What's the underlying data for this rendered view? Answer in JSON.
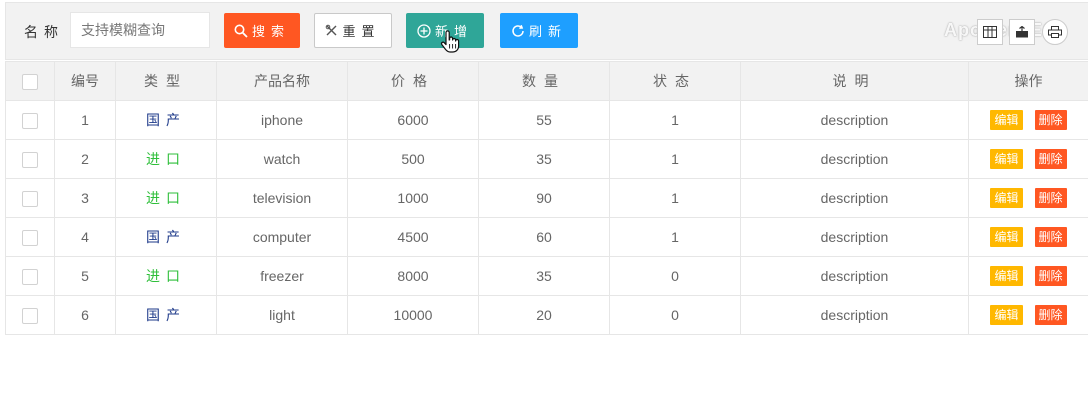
{
  "toolbar": {
    "name_label": "名称",
    "search_placeholder": "支持模糊查询",
    "search_label": "搜索",
    "reset_label": "重置",
    "add_label": "新增",
    "refresh_label": "刷新",
    "watermark": "ApowerREC",
    "colors": {
      "search": "#ff5722",
      "add": "#2fa698",
      "refresh": "#1e9fff"
    }
  },
  "table": {
    "columns": [
      "编号",
      "类型",
      "产品名称",
      "价格",
      "数量",
      "状态",
      "说明",
      "操作"
    ],
    "edit_label": "编辑",
    "delete_label": "删除",
    "rows": [
      {
        "id": "1",
        "type": "国产",
        "type_kind": "domestic",
        "name": "iphone",
        "price": "6000",
        "qty": "55",
        "status": "1",
        "desc": "description"
      },
      {
        "id": "2",
        "type": "进口",
        "type_kind": "import",
        "name": "watch",
        "price": "500",
        "qty": "35",
        "status": "1",
        "desc": "description"
      },
      {
        "id": "3",
        "type": "进口",
        "type_kind": "import",
        "name": "television",
        "price": "1000",
        "qty": "90",
        "status": "1",
        "desc": "description"
      },
      {
        "id": "4",
        "type": "国产",
        "type_kind": "domestic",
        "name": "computer",
        "price": "4500",
        "qty": "60",
        "status": "1",
        "desc": "description"
      },
      {
        "id": "5",
        "type": "进口",
        "type_kind": "import",
        "name": "freezer",
        "price": "8000",
        "qty": "35",
        "status": "0",
        "desc": "description"
      },
      {
        "id": "6",
        "type": "国产",
        "type_kind": "domestic",
        "name": "light",
        "price": "10000",
        "qty": "20",
        "status": "0",
        "desc": "description"
      }
    ]
  }
}
